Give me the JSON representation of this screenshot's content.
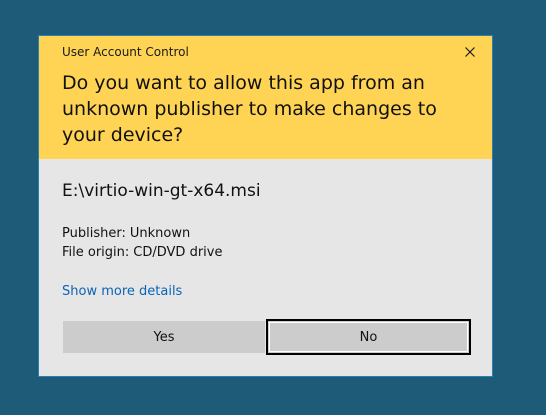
{
  "dialog": {
    "title": "User Account Control",
    "question": "Do you want to allow this app from an unknown publisher to make changes to your device?",
    "program_name": "E:\\virtio-win-gt-x64.msi",
    "publisher_label": "Publisher:",
    "publisher_value": "Unknown",
    "origin_label": "File origin:",
    "origin_value": "CD/DVD drive",
    "details_link": "Show more details",
    "yes_label": "Yes",
    "no_label": "No"
  },
  "colors": {
    "desktop": "#1d5b79",
    "header": "#ffd454",
    "body": "#e6e6e6",
    "button": "#cccccc",
    "link": "#0b63b8"
  },
  "icons": {
    "close": "close-icon"
  }
}
